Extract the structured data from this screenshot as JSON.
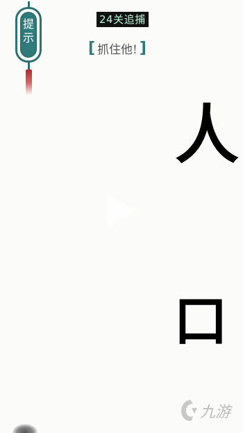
{
  "hint_button": {
    "label": "提示"
  },
  "level_title": "24关追捕",
  "subtitle": {
    "open": "[",
    "text": "抓住他!",
    "close": "]"
  },
  "characters": [
    "人",
    "口"
  ],
  "watermark": {
    "text": "九游"
  },
  "colors": {
    "accent": "#2f7b7b",
    "tassel": "#b12a2a",
    "badge_bg": "#111111",
    "badge_text": "#b9f7d8"
  }
}
